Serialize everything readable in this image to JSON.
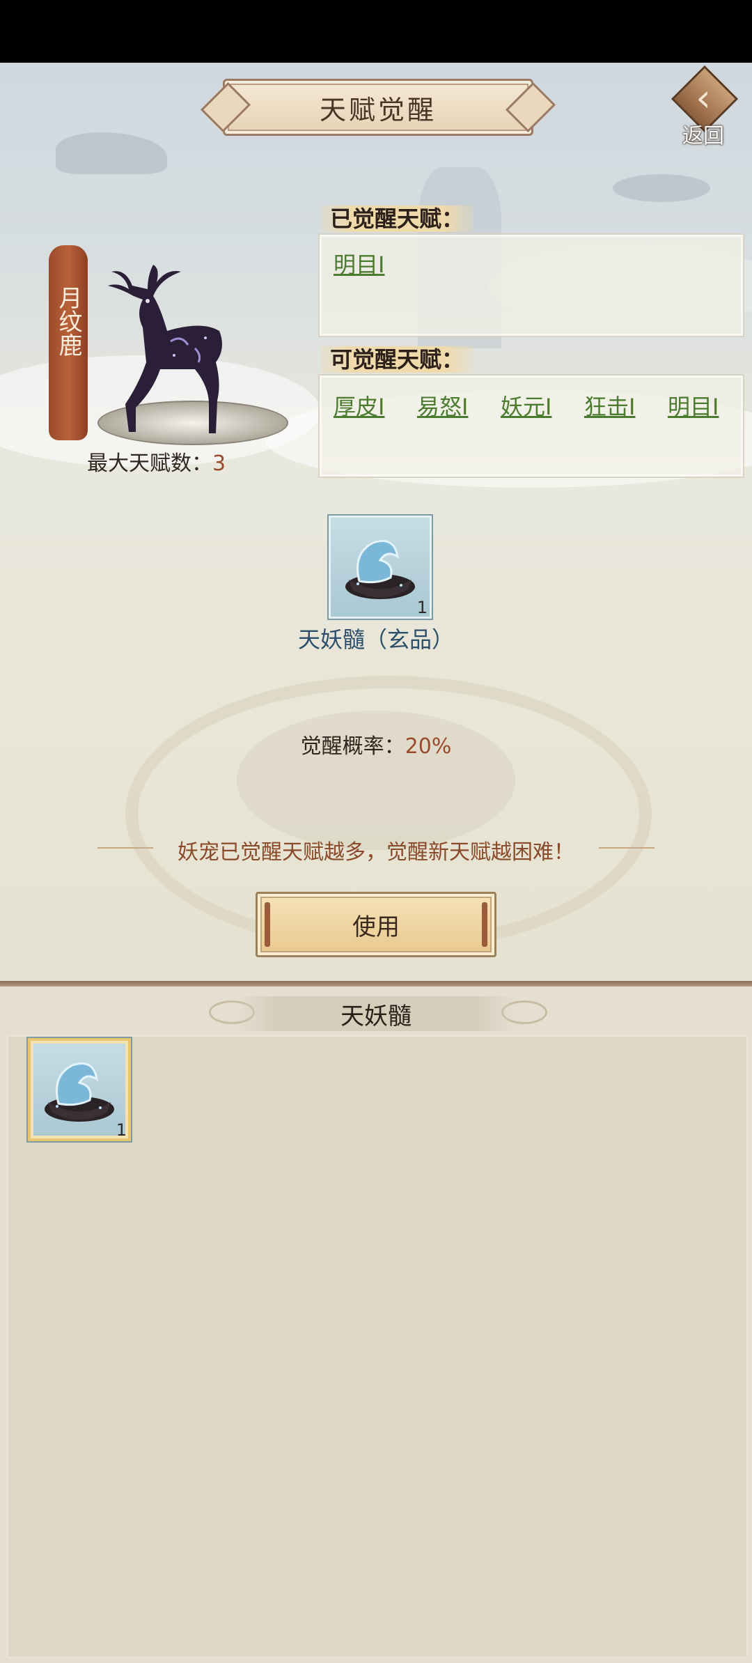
{
  "header": {
    "title": "天赋觉醒",
    "back_label": "返回"
  },
  "pet": {
    "name": "月纹鹿",
    "max_talent_label": "最大天赋数：",
    "max_talent_value": "3"
  },
  "awakened": {
    "label": "已觉醒天赋：",
    "talents": [
      "明目I"
    ]
  },
  "available": {
    "label": "可觉醒天赋：",
    "talents": [
      "厚皮I",
      "易怒I",
      "妖元I",
      "狂击I",
      "明目I"
    ]
  },
  "item": {
    "name": "天妖髓（玄品）",
    "count": "1",
    "icon": "water-spirit-bowl-icon"
  },
  "probability": {
    "label": "觉醒概率：",
    "value": "20%"
  },
  "hint": "妖宠已觉醒天赋越多，觉醒新天赋越困难！",
  "use_button": "使用",
  "inventory": {
    "title": "天妖髓",
    "items": [
      {
        "count": "1",
        "icon": "water-spirit-bowl-icon"
      }
    ]
  }
}
